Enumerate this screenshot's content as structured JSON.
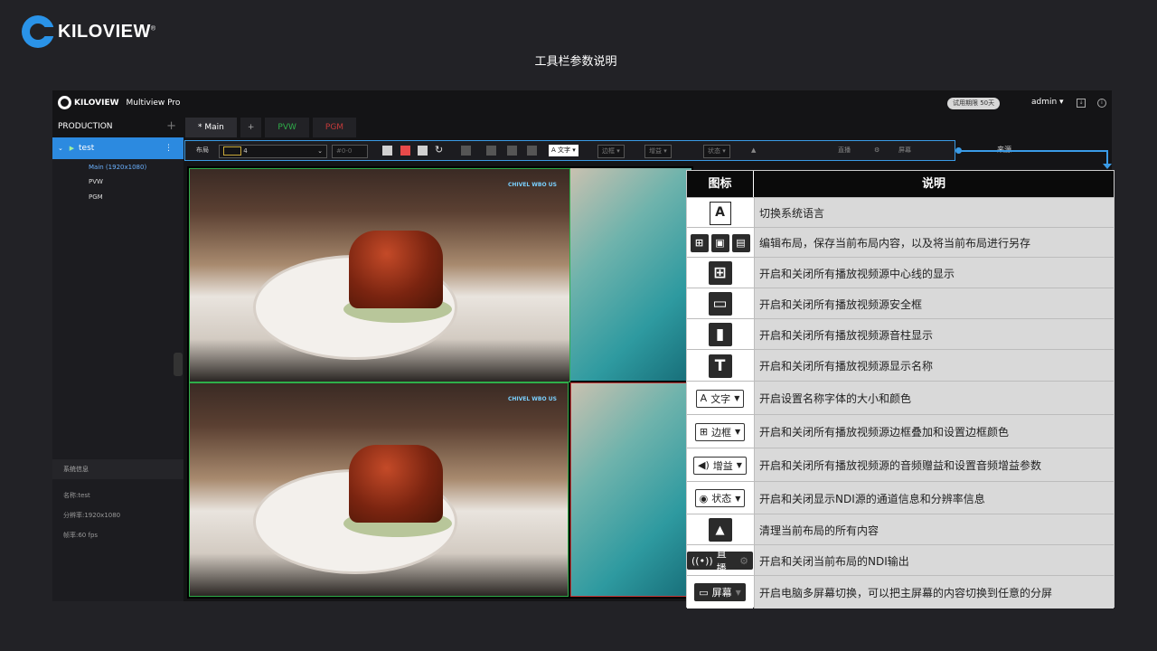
{
  "brand": {
    "name": "KILOVIEW",
    "registered": "®"
  },
  "page_title": "工具栏参数说明",
  "app": {
    "brand": "KILOVIEW",
    "product": "Multiview Pro",
    "trial_badge": "试用期限 50天",
    "user": "admin ▾"
  },
  "sidebar": {
    "header": "PRODUCTION",
    "add": "+",
    "project": "test",
    "items": [
      "Main (1920x1080)",
      "PVW",
      "PGM"
    ],
    "sys_title": "系统信息",
    "sys_lines": [
      "名称:test",
      "分辨率:1920x1080",
      "帧率:60 fps"
    ]
  },
  "tabs": [
    {
      "label": "* Main",
      "color": "#ffffff"
    },
    {
      "label": "+",
      "color": "#aaaaaa"
    },
    {
      "label": "PVW",
      "color": "#2fae4a"
    },
    {
      "label": "PGM",
      "color": "#c43a3a"
    }
  ],
  "toolbar": {
    "layout_label": "布局",
    "layout_value": "4",
    "source_select": "#0-0",
    "text_btn": "A 文字 ▾",
    "border_btn": "边框 ▾",
    "gain_btn": "增益 ▾",
    "status_btn": "状态 ▾",
    "live_btn": "直播",
    "screen_btn": "屏幕",
    "source_ref": "来源"
  },
  "video": {
    "watermark": "CHIVEL WBO US"
  },
  "legend": {
    "header_icon": "图标",
    "header_desc": "说明",
    "rows": [
      {
        "icon": "language-icon",
        "desc": "切换系统语言"
      },
      {
        "icon": "edit-save-saveas-icons",
        "desc": "编辑布局，保存当前布局内容，以及将当前布局进行另存"
      },
      {
        "icon": "center-line-icon",
        "desc": "开启和关闭所有播放视频源中心线的显示"
      },
      {
        "icon": "safe-frame-icon",
        "desc": "开启和关闭所有播放视频源安全框"
      },
      {
        "icon": "audio-meter-icon",
        "desc": "开启和关闭所有播放视频源音柱显示"
      },
      {
        "icon": "title-text-icon",
        "desc": "开启和关闭所有播放视频源显示名称"
      },
      {
        "icon": "text-dropdown",
        "label": "文字",
        "desc": "开启设置名称字体的大小和颜色"
      },
      {
        "icon": "border-dropdown",
        "label": "边框",
        "desc": "开启和关闭所有播放视频源边框叠加和设置边框颜色"
      },
      {
        "icon": "gain-dropdown",
        "label": "增益",
        "desc": "开启和关闭所有播放视频源的音频赠益和设置音频增益参数"
      },
      {
        "icon": "status-dropdown",
        "label": "状态",
        "desc": "开启和关闭显示NDI源的通道信息和分辨率信息"
      },
      {
        "icon": "broom-icon",
        "desc": "清理当前布局的所有内容"
      },
      {
        "icon": "live-button",
        "label": "直播",
        "desc": "开启和关闭当前布局的NDI输出"
      },
      {
        "icon": "screen-button",
        "label": "屏幕",
        "desc": "开启电脑多屏幕切换，可以把主屏幕的内容切换到任意的分屏"
      }
    ]
  }
}
